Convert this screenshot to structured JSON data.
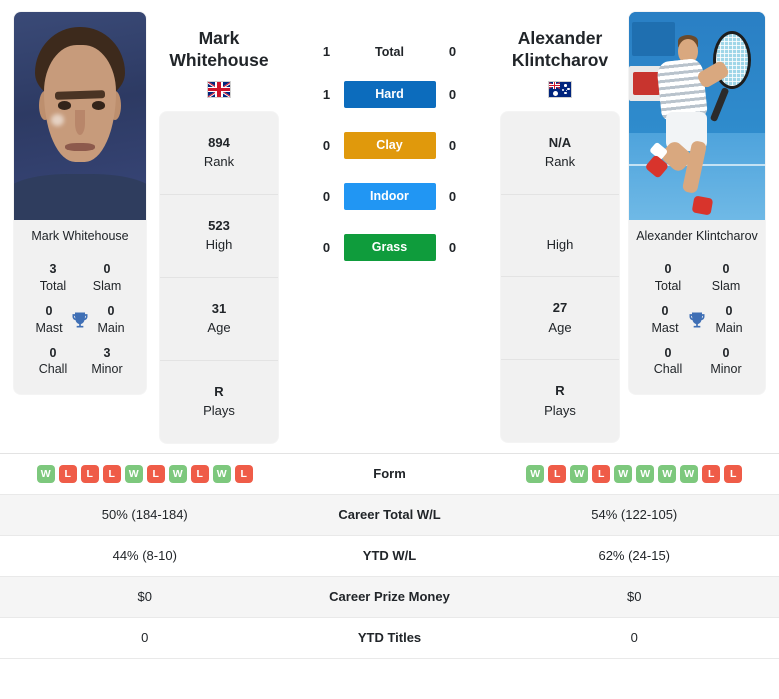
{
  "colors": {
    "hard": "#0c6cbd",
    "clay": "#e0990c",
    "indoor": "#2196f3",
    "grass": "#0f9c3c",
    "win": "#7dc87d",
    "loss": "#ef5c48",
    "trophy": "#3f6fb5",
    "panel": "#f1f1f1"
  },
  "left_player": {
    "name_line1": "Mark",
    "name_line2": "Whitehouse",
    "flag": "gb-flag-icon",
    "photo_caption": "Mark Whitehouse",
    "info": [
      {
        "value": "894",
        "label": "Rank"
      },
      {
        "value": "523",
        "label": "High"
      },
      {
        "value": "31",
        "label": "Age"
      },
      {
        "value": "R",
        "label": "Plays"
      }
    ],
    "titles": [
      {
        "value": "3",
        "label": "Total"
      },
      {
        "value": "0",
        "label": "Slam"
      },
      {
        "value": "0",
        "label": "Mast"
      },
      {
        "value": "0",
        "label": "Main"
      },
      {
        "value": "0",
        "label": "Chall"
      },
      {
        "value": "3",
        "label": "Minor"
      }
    ],
    "form": [
      "W",
      "L",
      "L",
      "L",
      "W",
      "L",
      "W",
      "L",
      "W",
      "L"
    ],
    "career_total_wl": "50% (184-184)",
    "ytd_wl": "44% (8-10)",
    "career_prize_money": "$0",
    "ytd_titles": "0"
  },
  "right_player": {
    "name_line1": "Alexander",
    "name_line2": "Klintcharov",
    "flag": "au-flag-icon",
    "photo_caption": "Alexander Klintcharov",
    "info": [
      {
        "value": "N/A",
        "label": "Rank"
      },
      {
        "value": "",
        "label": "High"
      },
      {
        "value": "27",
        "label": "Age"
      },
      {
        "value": "R",
        "label": "Plays"
      }
    ],
    "titles": [
      {
        "value": "0",
        "label": "Total"
      },
      {
        "value": "0",
        "label": "Slam"
      },
      {
        "value": "0",
        "label": "Mast"
      },
      {
        "value": "0",
        "label": "Main"
      },
      {
        "value": "0",
        "label": "Chall"
      },
      {
        "value": "0",
        "label": "Minor"
      }
    ],
    "form": [
      "W",
      "L",
      "W",
      "L",
      "W",
      "W",
      "W",
      "W",
      "L",
      "L"
    ],
    "career_total_wl": "54% (122-105)",
    "ytd_wl": "62% (24-15)",
    "career_prize_money": "$0",
    "ytd_titles": "0"
  },
  "h2h": {
    "total": {
      "label": "Total",
      "left": "1",
      "right": "0"
    },
    "surfaces": [
      {
        "label": "Hard",
        "left": "1",
        "right": "0"
      },
      {
        "label": "Clay",
        "left": "0",
        "right": "0"
      },
      {
        "label": "Indoor",
        "left": "0",
        "right": "0"
      },
      {
        "label": "Grass",
        "left": "0",
        "right": "0"
      }
    ]
  },
  "table": {
    "rows": [
      {
        "label": "Form"
      },
      {
        "label": "Career Total W/L"
      },
      {
        "label": "YTD W/L"
      },
      {
        "label": "Career Prize Money"
      },
      {
        "label": "YTD Titles"
      }
    ]
  }
}
